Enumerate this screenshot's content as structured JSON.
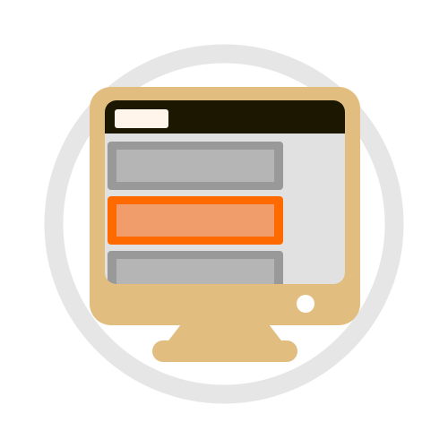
{
  "illustration": {
    "name": "monitor-list-icon",
    "colors": {
      "background": "#ffffff",
      "ring": "#e6e6e6",
      "monitor_body": "#e2bd80",
      "title_bar": "#1b1700",
      "title_pill": "#fff5ea",
      "screen": "#e1e1e1",
      "list_item_border": "#999999",
      "list_item_fill": "#b5b5b5",
      "selected_item_border": "#ff6a00",
      "selected_item_fill": "#f19d6b",
      "power_button": "#ffffff"
    },
    "list_items": [
      {
        "state": "default"
      },
      {
        "state": "selected"
      },
      {
        "state": "default"
      }
    ]
  }
}
